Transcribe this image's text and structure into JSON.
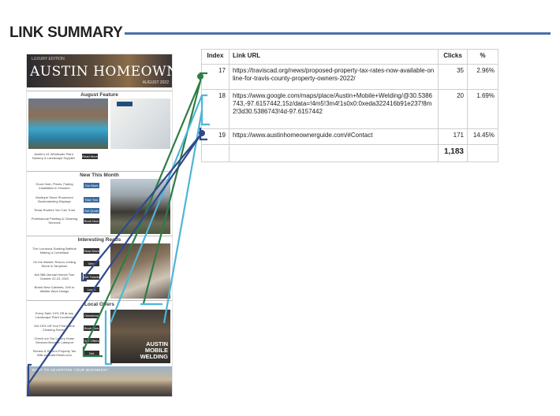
{
  "header": {
    "title": "LINK SUMMARY"
  },
  "newsletter": {
    "banner_sup": "LUXURY EDITION",
    "brand": "AUSTIN HOMEOWNER",
    "banner_date": "AUGUST 2022",
    "sections": [
      "August Feature",
      "New This Month",
      "Interesting Reads",
      "Local Offers"
    ],
    "feature_caption": "Austin's #1 Wholesale Plant Nursery & Landscape Supplier",
    "feature_button": "Read More",
    "bath_tag": "REMODEL",
    "new_items": [
      "Good Gain, Prices, Fading Installation in Houston",
      "Boutique Stone Showroom Bookmatching Displays",
      "Texas Roofers You Can Trust",
      "Professional Painting & Cleaning Services"
    ],
    "new_buttons": [
      "Our Work",
      "Take Tour",
      "Get Quote",
      "Book Now"
    ],
    "read_items": [
      "The Luxurious Soaking Bathtub Making a Comeback",
      "On the Market: Rest-to-Ceiling Stone in Tarrytown",
      "AIA 36th Annual Homes Tour October 22-23, 2022",
      "Brand New Cabinets, Grill or Wildlife Work Design"
    ],
    "read_buttons": [
      "Read More",
      "View Home",
      "Get Tickets",
      "Learn More"
    ],
    "offer_items": [
      "Every Sale! 10% Off at any Landscape Plant Locations",
      "Get 15% Off Your First Home Cleaning Service",
      "Check out Our Luxury Home Services Brand in Lakeport",
      "Review & Reform Property Tax Bills w/ AustinTaxes.com"
    ],
    "offer_buttons": [
      "Directions",
      "Book Now",
      "See Offers",
      "Get Started"
    ],
    "weld_text": "AUSTIN MOBILE WELDING",
    "skyline_text": "WANT TO ADVERTISE YOUR BUSINESS?"
  },
  "table": {
    "headers": [
      "Index",
      "Link URL",
      "Clicks",
      "%"
    ],
    "rows": [
      {
        "index": "17",
        "url": "https://traviscad.org/news/proposed-property-tax-rates-now-available-online-for-travis-county-property-owners-2022/",
        "clicks": "35",
        "pct": "2.96%"
      },
      {
        "index": "18",
        "url": "https://www.google.com/maps/place/Austin+Mobile+Welding/@30.5386743,-97.6157442,15z/data=!4m5!3m4!1s0x0:0xeda322416b91e237!8m2!3d30.5386743!4d-97.6157442",
        "clicks": "20",
        "pct": "1.69%"
      },
      {
        "index": "19",
        "url": "https://www.austinhomeownerguide.com/#Contact",
        "clicks": "171",
        "pct": "14.45%"
      }
    ],
    "total": "1,183"
  },
  "colors": {
    "green": "#2e7d45",
    "lightblue": "#4db6d6",
    "navy": "#2f4a8a",
    "rule": "#4a6fa5"
  }
}
